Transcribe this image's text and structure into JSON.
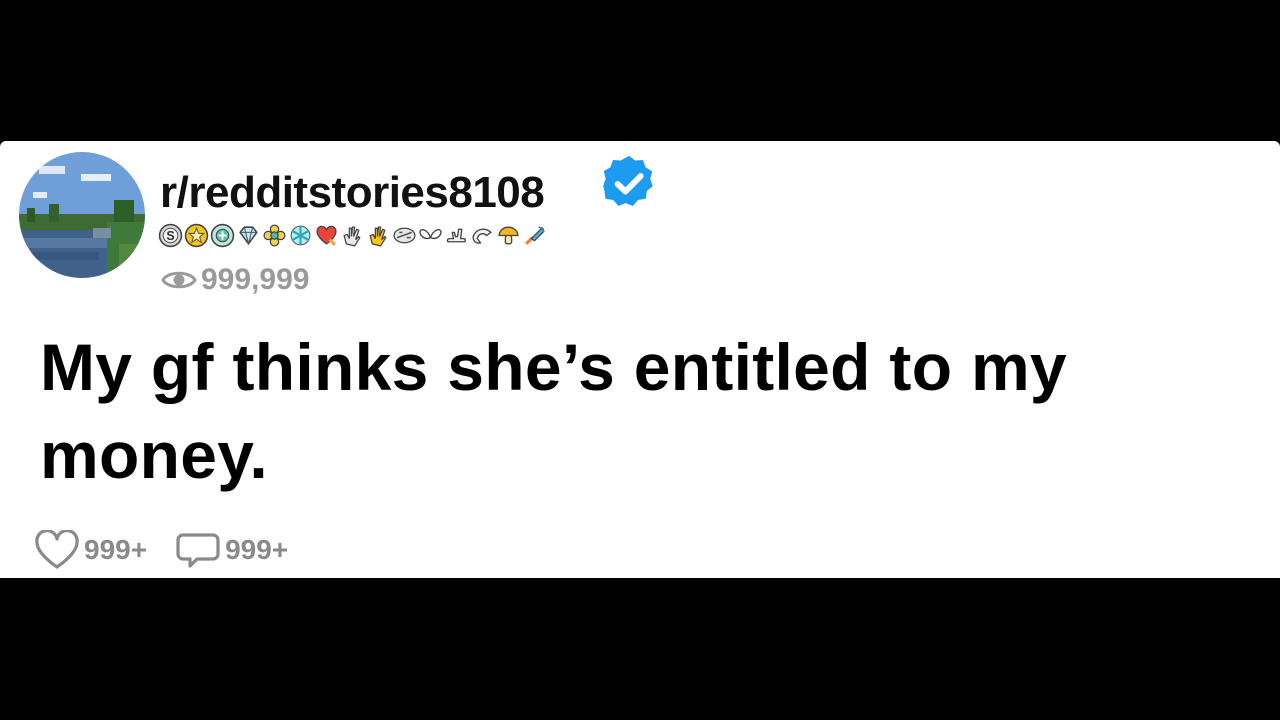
{
  "post": {
    "username": "r/redditstories8108",
    "views": "999,999",
    "title": "My gf thinks she’s entitled to my money.",
    "likes": "999+",
    "comments": "999+"
  },
  "icons": {
    "avatar": "landscape-avatar",
    "verified": "verified-check-icon",
    "views": "eye-icon",
    "likes": "heart-icon",
    "comments": "comment-bubble-icon"
  },
  "awards": [
    "silver-award-icon",
    "gold-star-award-icon",
    "platinum-award-icon",
    "diamond-award-icon",
    "flower-award-icon",
    "snowflake-award-icon",
    "heart-rocket-award-icon",
    "clap-award-icon",
    "gold-clap-award-icon",
    "wink-award-icon",
    "wings-award-icon",
    "hand-award-icon",
    "wave-award-icon",
    "mushroom-award-icon",
    "dart-award-icon"
  ],
  "colors": {
    "background": "#000000",
    "card": "#ffffff",
    "verified": "#1d9bf0",
    "muted": "#9a9a9a"
  }
}
